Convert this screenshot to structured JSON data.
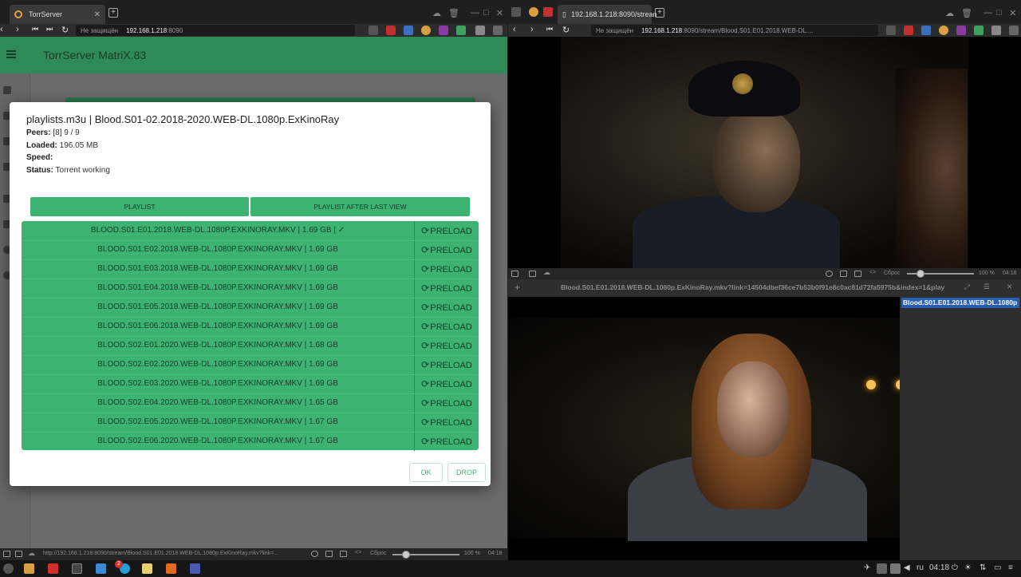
{
  "left_browser": {
    "tab_title": "TorrServer",
    "url_warning": "Не защищён",
    "url_host": "192.168.1.218",
    "url_path": ":8090",
    "app_title": "TorrServer MatriX.83",
    "status_url": "http://192.168.1.218:8090/stream/Blood.S01.E01.2018.WEB-DL.1080p.ExKinoRay.mkv?link=...",
    "reset_label": "Сброс",
    "zoom": "100 %",
    "time": "04:18"
  },
  "dialog": {
    "title": "playlists.m3u | Blood.S01-02.2018-2020.WEB-DL.1080p.ExKinoRay",
    "peers_label": "Peers:",
    "peers_value": "[8] 9 / 9",
    "loaded_label": "Loaded:",
    "loaded_value": "196.05 MB",
    "speed_label": "Speed:",
    "speed_value": "",
    "status_label": "Status:",
    "status_value": "Torrent working",
    "playlist_button": "PLAYLIST",
    "playlist_after_button": "PLAYLIST AFTER LAST VIEW",
    "preload_label": "PRELOAD",
    "files": [
      "BLOOD.S01.E01.2018.WEB-DL.1080P.EXKINORAY.MKV | 1.69 GB | ✓",
      "BLOOD.S01.E02.2018.WEB-DL.1080P.EXKINORAY.MKV | 1.69 GB",
      "BLOOD.S01.E03.2018.WEB-DL.1080P.EXKINORAY.MKV | 1.69 GB",
      "BLOOD.S01.E04.2018.WEB-DL.1080P.EXKINORAY.MKV | 1.69 GB",
      "BLOOD.S01.E05.2018.WEB-DL.1080P.EXKINORAY.MKV | 1.69 GB",
      "BLOOD.S01.E06.2018.WEB-DL.1080P.EXKINORAY.MKV | 1.69 GB",
      "BLOOD.S02.E01.2020.WEB-DL.1080P.EXKINORAY.MKV | 1.68 GB",
      "BLOOD.S02.E02.2020.WEB-DL.1080P.EXKINORAY.MKV | 1.69 GB",
      "BLOOD.S02.E03.2020.WEB-DL.1080P.EXKINORAY.MKV | 1.69 GB",
      "BLOOD.S02.E04.2020.WEB-DL.1080P.EXKINORAY.MKV | 1.65 GB",
      "BLOOD.S02.E05.2020.WEB-DL.1080P.EXKINORAY.MKV | 1.67 GB",
      "BLOOD.S02.E06.2020.WEB-DL.1080P.EXKINORAY.MKV | 1.67 GB"
    ],
    "ok_button": "OK",
    "drop_button": "DROP"
  },
  "right_browser": {
    "tab_title": "192.168.1.218:8090/strean",
    "url_warning": "Не защищён",
    "url_host": "192.168.1.218",
    "url_path": ":8090/stream/Blood.S01.E01.2018.WEB-DL....",
    "reset_label": "Сброс",
    "zoom": "100 %",
    "time": "04:18",
    "player_title": "Blood.S01.E01.2018.WEB-DL.1080p.ExKinoRay.mkv?link=14504dbef36ce7b53b0f91e8c0ac81d72fa5975b&index=1&play",
    "playlist_selected": "Blood.S01.E01.2018.WEB-DL.1080p"
  },
  "taskbar": {
    "telegram_badge": "2",
    "lang": "ru",
    "clock": "04:18"
  },
  "colors": {
    "accent_green": "#3cb371",
    "header_green": "#2e8b57",
    "selection_blue": "#2a5fb0"
  }
}
